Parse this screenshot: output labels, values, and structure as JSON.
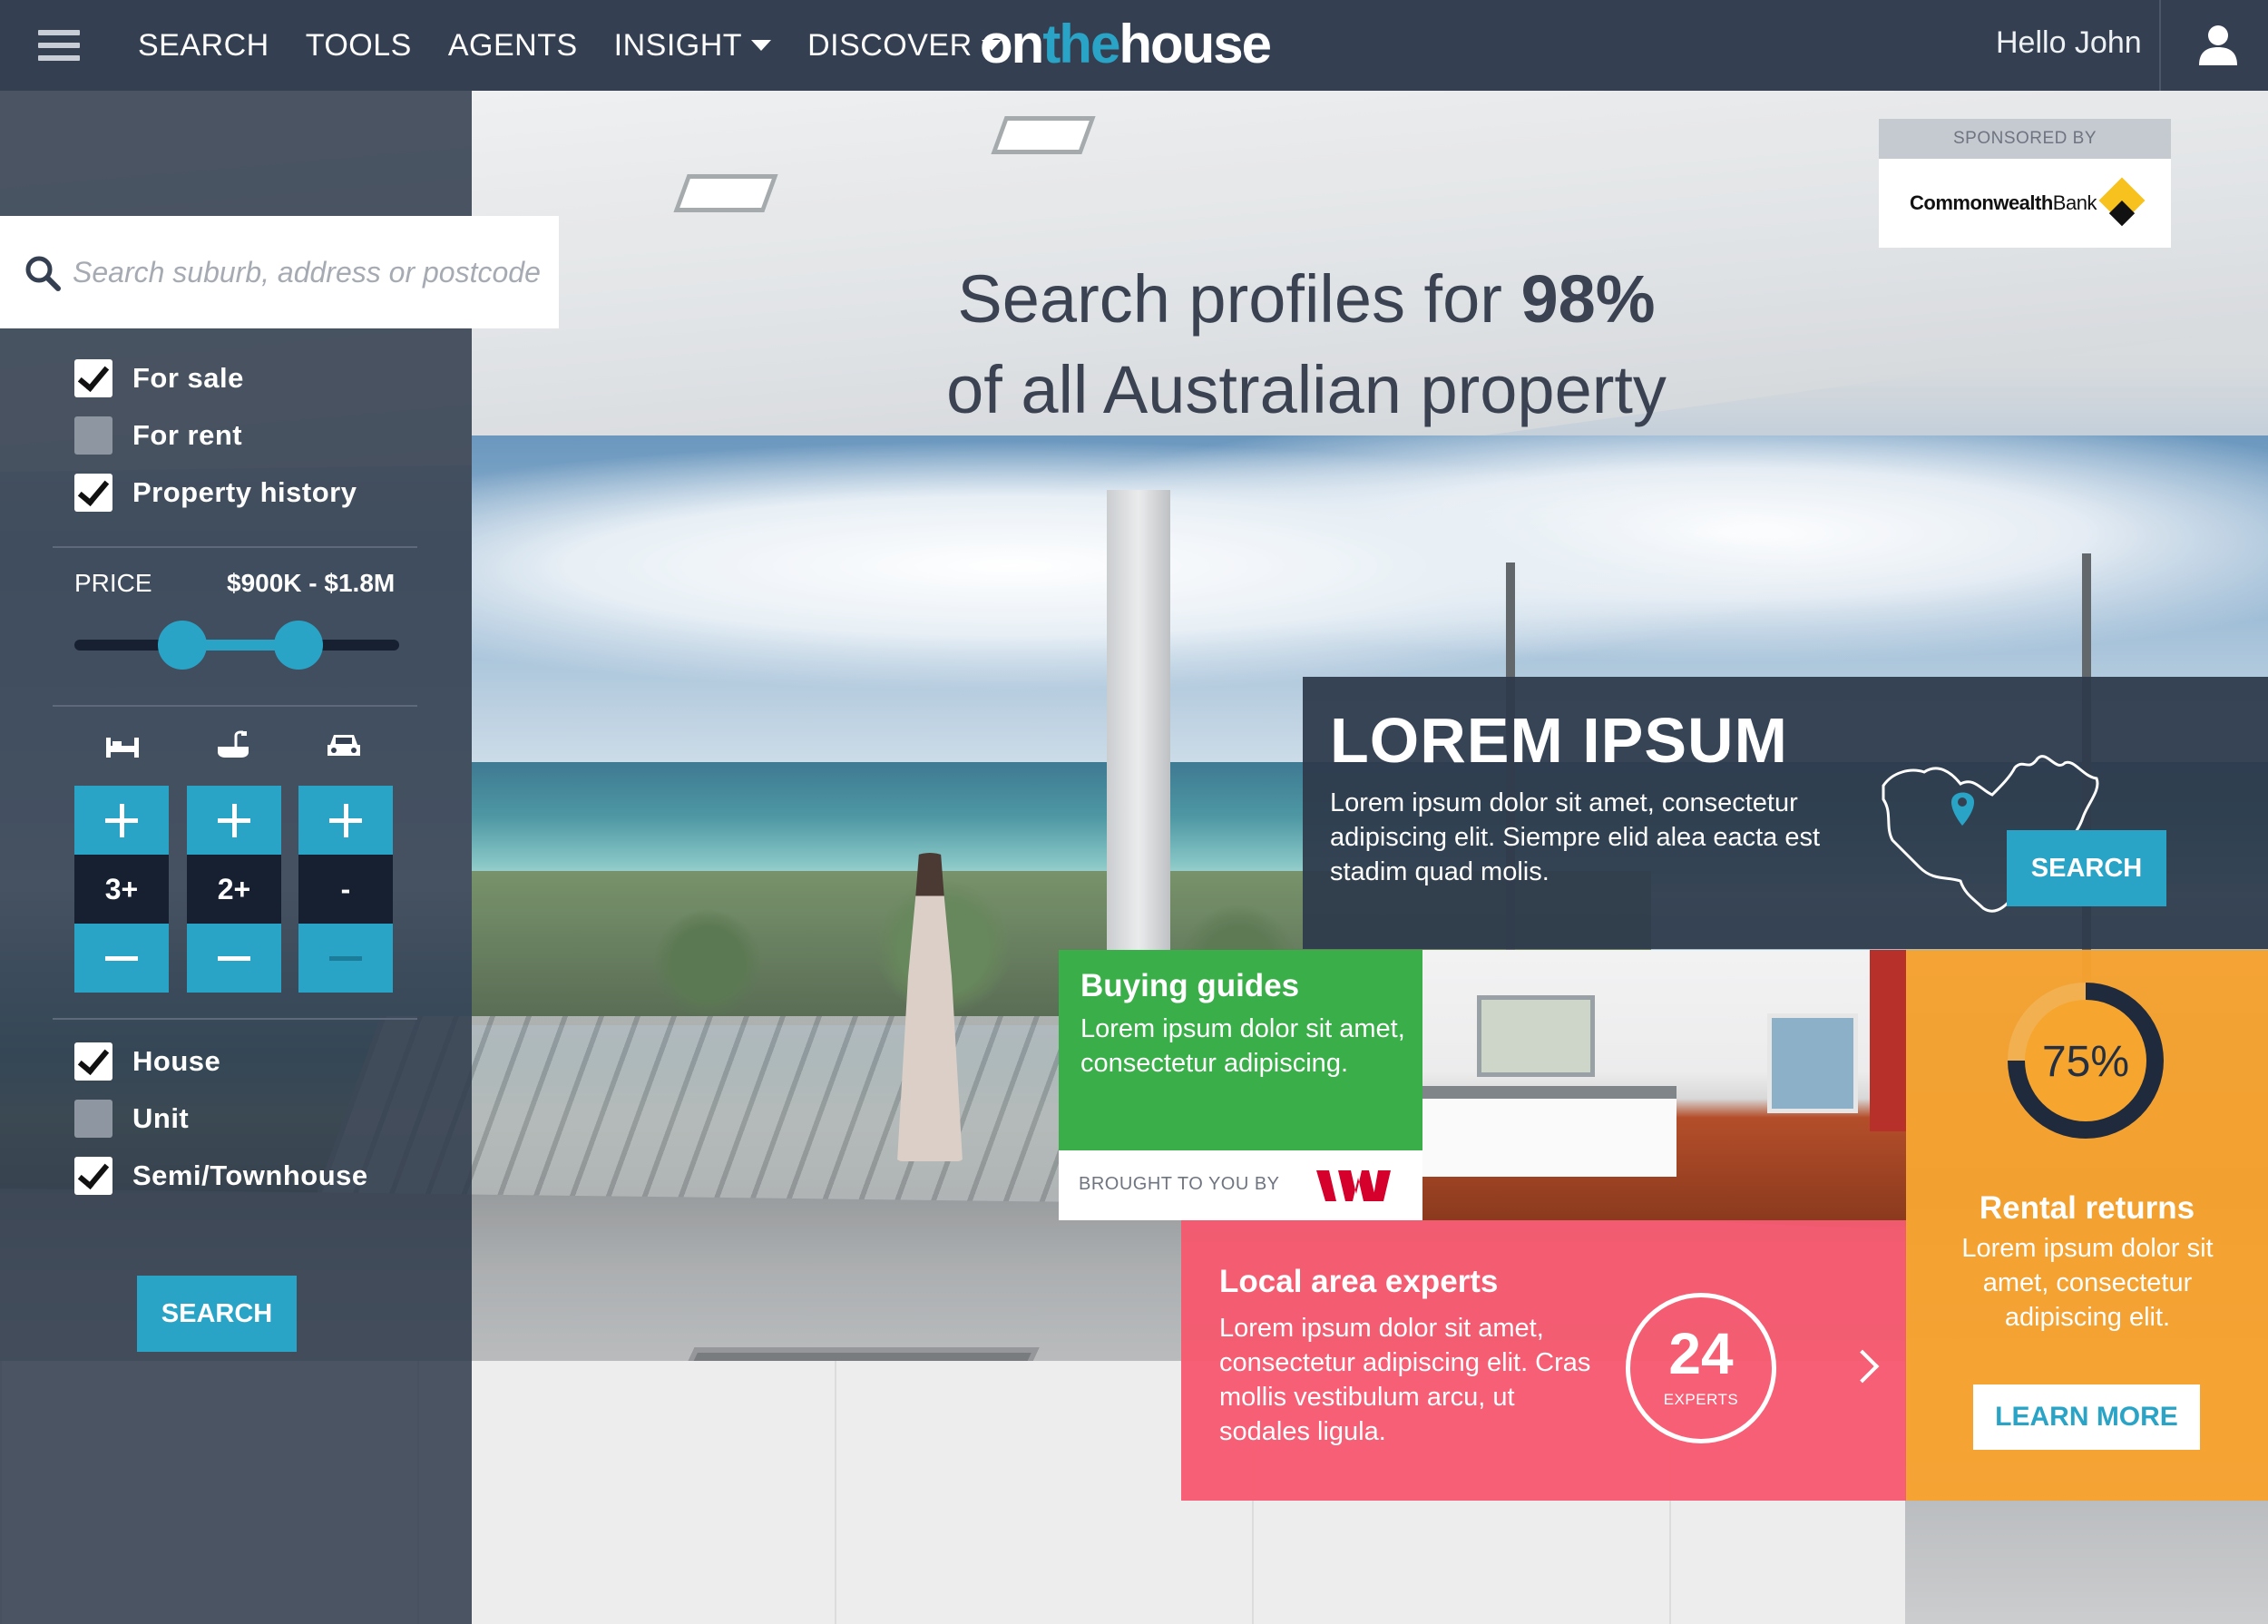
{
  "nav": {
    "links": [
      {
        "label": "SEARCH"
      },
      {
        "label": "TOOLS"
      },
      {
        "label": "AGENTS"
      },
      {
        "label": "INSIGHT"
      },
      {
        "label": "DISCOVER"
      }
    ],
    "logo_part1": "on",
    "logo_part2": "the",
    "logo_part3": "house",
    "greeting": "Hello John"
  },
  "search": {
    "placeholder": "Search suburb, address or postcode"
  },
  "filters": {
    "listing_types": [
      {
        "label": "For sale",
        "checked": true
      },
      {
        "label": "For rent",
        "checked": false
      },
      {
        "label": "Property history",
        "checked": true
      }
    ],
    "price_label": "PRICE",
    "price_value": "$900K - $1.8M",
    "steppers": [
      {
        "icon": "bed-icon",
        "value": "3+"
      },
      {
        "icon": "bath-icon",
        "value": "2+"
      },
      {
        "icon": "car-icon",
        "value": "-"
      }
    ],
    "property_types": [
      {
        "label": "House",
        "checked": true
      },
      {
        "label": "Unit",
        "checked": false
      },
      {
        "label": "Semi/Townhouse",
        "checked": true
      }
    ],
    "search_label": "SEARCH"
  },
  "sponsor": {
    "label": "SPONSORED BY",
    "bank_bold": "Commonwealth",
    "bank_light": "Bank"
  },
  "headline": {
    "line1_pre": "Search profiles for ",
    "line1_bold": "98%",
    "line2": "of all Australian property"
  },
  "promo": {
    "title": "LOREM IPSUM",
    "text": "Lorem ipsum dolor sit amet, consectetur adipiscing elit. Siempre elid alea eacta est stadim quad molis.",
    "button": "SEARCH"
  },
  "guides": {
    "title": "Buying guides",
    "text": "Lorem ipsum dolor sit amet, consectetur adipiscing.",
    "brought_by": "BROUGHT TO YOU BY"
  },
  "experts": {
    "title": "Local area experts",
    "text": "Lorem ipsum dolor sit amet, consectetur adipiscing elit. Cras mollis vestibulum arcu, ut sodales ligula.",
    "count": "24",
    "count_label": "EXPERTS"
  },
  "rental": {
    "percent": "75%",
    "title": "Rental returns",
    "text": "Lorem ipsum dolor sit amet, consectetur adipiscing elit.",
    "button": "LEARN MORE"
  },
  "colors": {
    "nav_bg": "#344052",
    "accent": "#2aa4c6",
    "green": "#3aae49",
    "pink": "#f7576e",
    "orange": "#f8a22e"
  }
}
